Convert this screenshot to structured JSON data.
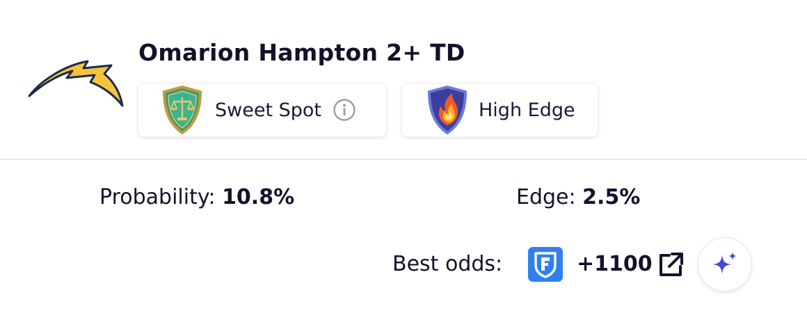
{
  "prop": {
    "title": "Omarion Hampton 2+ TD",
    "team_logo_icon": "chargers-bolt-logo"
  },
  "badges": [
    {
      "label": "Sweet Spot",
      "icon": "scales-shield-icon",
      "has_info": true
    },
    {
      "label": "High Edge",
      "icon": "flame-shield-icon",
      "has_info": false
    }
  ],
  "stats": {
    "probability_label": "Probability:",
    "probability_value": "10.8%",
    "edge_label": "Edge:",
    "edge_value": "2.5%"
  },
  "odds": {
    "label": "Best odds:",
    "sportsbook_icon": "fanduel-logo",
    "value": "+1100"
  },
  "colors": {
    "text": "#12122b",
    "bolt_yellow": "#f7c33c",
    "bolt_navy": "#1b2a4a",
    "sportsbook_blue": "#2f80ed",
    "ai_sparkle": "#3f48d8",
    "divider": "#e5e7eb"
  }
}
